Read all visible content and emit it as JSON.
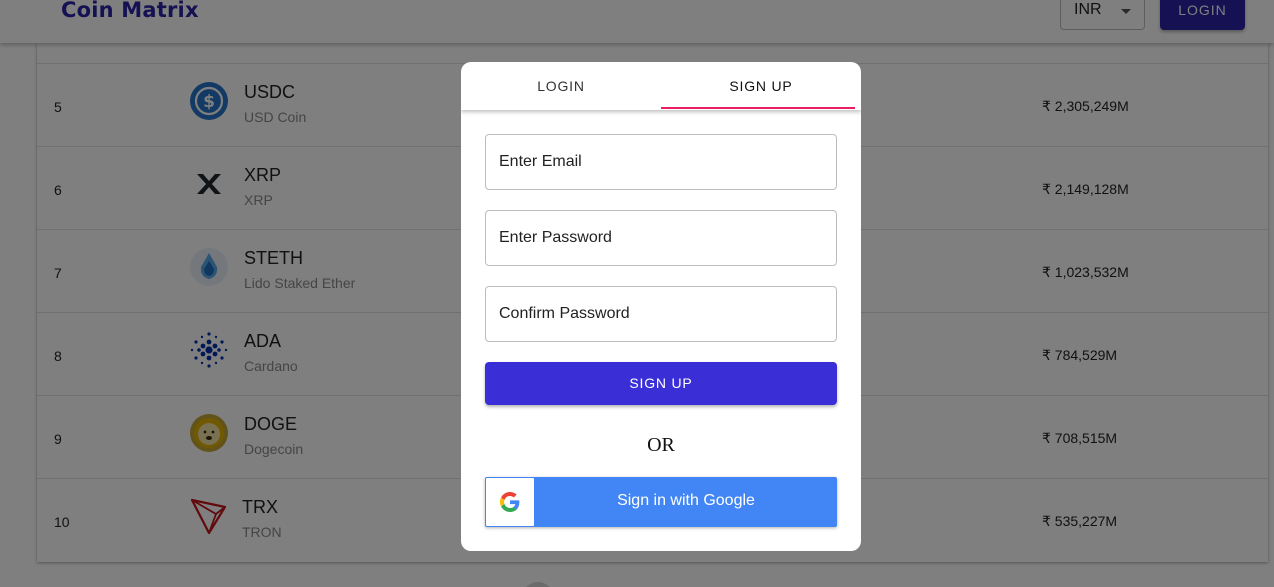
{
  "header": {
    "brand": "Coin Matrix",
    "currency": "INR",
    "login_label": "LOGIN"
  },
  "table": {
    "rows": [
      {
        "rank": "5",
        "symbol": "USDC",
        "name": "USD Coin",
        "market_cap": "₹ 2,305,249M",
        "icon": "usdc-icon"
      },
      {
        "rank": "6",
        "symbol": "XRP",
        "name": "XRP",
        "market_cap": "₹ 2,149,128M",
        "icon": "xrp-icon"
      },
      {
        "rank": "7",
        "symbol": "STETH",
        "name": "Lido Staked Ether",
        "market_cap": "₹ 1,023,532M",
        "icon": "steth-icon"
      },
      {
        "rank": "8",
        "symbol": "ADA",
        "name": "Cardano",
        "market_cap": "₹ 784,529M",
        "icon": "ada-icon"
      },
      {
        "rank": "9",
        "symbol": "DOGE",
        "name": "Dogecoin",
        "market_cap": "₹ 708,515M",
        "icon": "doge-icon"
      },
      {
        "rank": "10",
        "symbol": "TRX",
        "name": "TRON",
        "market_cap": "₹ 535,227M",
        "icon": "trx-icon"
      }
    ]
  },
  "modal": {
    "tabs": [
      {
        "label": "LOGIN",
        "active": false
      },
      {
        "label": "SIGN UP",
        "active": true
      }
    ],
    "email_placeholder": "Enter Email",
    "password_placeholder": "Enter Password",
    "confirm_placeholder": "Confirm Password",
    "signup_label": "SIGN UP",
    "or_text": "OR",
    "google_label": "Sign in with Google"
  },
  "colors": {
    "brand": "#2a23a6",
    "primary_button": "#3a2fd6",
    "tab_indicator": "#e91e63",
    "google_blue": "#4285f4"
  }
}
